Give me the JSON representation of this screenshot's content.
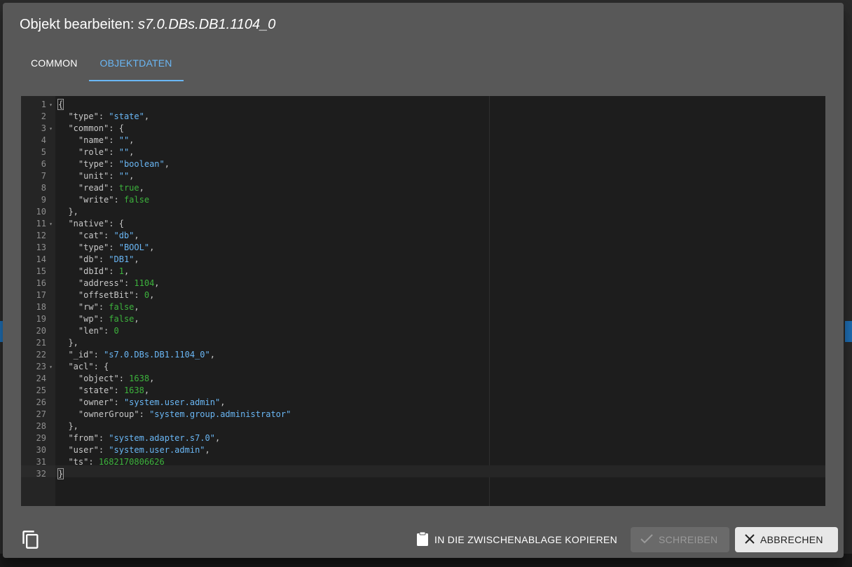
{
  "dialog": {
    "title_prefix": "Objekt bearbeiten: ",
    "title_object_id": "s7.0.DBs.DB1.1104_0",
    "tabs": [
      {
        "label": "COMMON",
        "active": false
      },
      {
        "label": "OBJEKTDATEN",
        "active": true
      }
    ]
  },
  "editor": {
    "language": "json",
    "active_line": 32,
    "lines": [
      {
        "n": "1",
        "fold": true,
        "tokens": [
          [
            "p",
            "{"
          ]
        ]
      },
      {
        "n": "2",
        "fold": false,
        "tokens": [
          [
            "p",
            "  "
          ],
          [
            "k",
            "\"type\""
          ],
          [
            "p",
            ": "
          ],
          [
            "s",
            "\"state\""
          ],
          [
            "p",
            ","
          ]
        ]
      },
      {
        "n": "3",
        "fold": true,
        "tokens": [
          [
            "p",
            "  "
          ],
          [
            "k",
            "\"common\""
          ],
          [
            "p",
            ": {"
          ]
        ]
      },
      {
        "n": "4",
        "fold": false,
        "tokens": [
          [
            "p",
            "    "
          ],
          [
            "k",
            "\"name\""
          ],
          [
            "p",
            ": "
          ],
          [
            "s",
            "\"\""
          ],
          [
            "p",
            ","
          ]
        ]
      },
      {
        "n": "5",
        "fold": false,
        "tokens": [
          [
            "p",
            "    "
          ],
          [
            "k",
            "\"role\""
          ],
          [
            "p",
            ": "
          ],
          [
            "s",
            "\"\""
          ],
          [
            "p",
            ","
          ]
        ]
      },
      {
        "n": "6",
        "fold": false,
        "tokens": [
          [
            "p",
            "    "
          ],
          [
            "k",
            "\"type\""
          ],
          [
            "p",
            ": "
          ],
          [
            "s",
            "\"boolean\""
          ],
          [
            "p",
            ","
          ]
        ]
      },
      {
        "n": "7",
        "fold": false,
        "tokens": [
          [
            "p",
            "    "
          ],
          [
            "k",
            "\"unit\""
          ],
          [
            "p",
            ": "
          ],
          [
            "s",
            "\"\""
          ],
          [
            "p",
            ","
          ]
        ]
      },
      {
        "n": "8",
        "fold": false,
        "tokens": [
          [
            "p",
            "    "
          ],
          [
            "k",
            "\"read\""
          ],
          [
            "p",
            ": "
          ],
          [
            "n",
            "true"
          ],
          [
            "p",
            ","
          ]
        ]
      },
      {
        "n": "9",
        "fold": false,
        "tokens": [
          [
            "p",
            "    "
          ],
          [
            "k",
            "\"write\""
          ],
          [
            "p",
            ": "
          ],
          [
            "n",
            "false"
          ]
        ]
      },
      {
        "n": "10",
        "fold": false,
        "tokens": [
          [
            "p",
            "  },"
          ]
        ]
      },
      {
        "n": "11",
        "fold": true,
        "tokens": [
          [
            "p",
            "  "
          ],
          [
            "k",
            "\"native\""
          ],
          [
            "p",
            ": {"
          ]
        ]
      },
      {
        "n": "12",
        "fold": false,
        "tokens": [
          [
            "p",
            "    "
          ],
          [
            "k",
            "\"cat\""
          ],
          [
            "p",
            ": "
          ],
          [
            "s",
            "\"db\""
          ],
          [
            "p",
            ","
          ]
        ]
      },
      {
        "n": "13",
        "fold": false,
        "tokens": [
          [
            "p",
            "    "
          ],
          [
            "k",
            "\"type\""
          ],
          [
            "p",
            ": "
          ],
          [
            "s",
            "\"BOOL\""
          ],
          [
            "p",
            ","
          ]
        ]
      },
      {
        "n": "14",
        "fold": false,
        "tokens": [
          [
            "p",
            "    "
          ],
          [
            "k",
            "\"db\""
          ],
          [
            "p",
            ": "
          ],
          [
            "s",
            "\"DB1\""
          ],
          [
            "p",
            ","
          ]
        ]
      },
      {
        "n": "15",
        "fold": false,
        "tokens": [
          [
            "p",
            "    "
          ],
          [
            "k",
            "\"dbId\""
          ],
          [
            "p",
            ": "
          ],
          [
            "n",
            "1"
          ],
          [
            "p",
            ","
          ]
        ]
      },
      {
        "n": "16",
        "fold": false,
        "tokens": [
          [
            "p",
            "    "
          ],
          [
            "k",
            "\"address\""
          ],
          [
            "p",
            ": "
          ],
          [
            "n",
            "1104"
          ],
          [
            "p",
            ","
          ]
        ]
      },
      {
        "n": "17",
        "fold": false,
        "tokens": [
          [
            "p",
            "    "
          ],
          [
            "k",
            "\"offsetBit\""
          ],
          [
            "p",
            ": "
          ],
          [
            "n",
            "0"
          ],
          [
            "p",
            ","
          ]
        ]
      },
      {
        "n": "18",
        "fold": false,
        "tokens": [
          [
            "p",
            "    "
          ],
          [
            "k",
            "\"rw\""
          ],
          [
            "p",
            ": "
          ],
          [
            "n",
            "false"
          ],
          [
            "p",
            ","
          ]
        ]
      },
      {
        "n": "19",
        "fold": false,
        "tokens": [
          [
            "p",
            "    "
          ],
          [
            "k",
            "\"wp\""
          ],
          [
            "p",
            ": "
          ],
          [
            "n",
            "false"
          ],
          [
            "p",
            ","
          ]
        ]
      },
      {
        "n": "20",
        "fold": false,
        "tokens": [
          [
            "p",
            "    "
          ],
          [
            "k",
            "\"len\""
          ],
          [
            "p",
            ": "
          ],
          [
            "n",
            "0"
          ]
        ]
      },
      {
        "n": "21",
        "fold": false,
        "tokens": [
          [
            "p",
            "  },"
          ]
        ]
      },
      {
        "n": "22",
        "fold": false,
        "tokens": [
          [
            "p",
            "  "
          ],
          [
            "k",
            "\"_id\""
          ],
          [
            "p",
            ": "
          ],
          [
            "s",
            "\"s7.0.DBs.DB1.1104_0\""
          ],
          [
            "p",
            ","
          ]
        ]
      },
      {
        "n": "23",
        "fold": true,
        "tokens": [
          [
            "p",
            "  "
          ],
          [
            "k",
            "\"acl\""
          ],
          [
            "p",
            ": {"
          ]
        ]
      },
      {
        "n": "24",
        "fold": false,
        "tokens": [
          [
            "p",
            "    "
          ],
          [
            "k",
            "\"object\""
          ],
          [
            "p",
            ": "
          ],
          [
            "n",
            "1638"
          ],
          [
            "p",
            ","
          ]
        ]
      },
      {
        "n": "25",
        "fold": false,
        "tokens": [
          [
            "p",
            "    "
          ],
          [
            "k",
            "\"state\""
          ],
          [
            "p",
            ": "
          ],
          [
            "n",
            "1638"
          ],
          [
            "p",
            ","
          ]
        ]
      },
      {
        "n": "26",
        "fold": false,
        "tokens": [
          [
            "p",
            "    "
          ],
          [
            "k",
            "\"owner\""
          ],
          [
            "p",
            ": "
          ],
          [
            "s",
            "\"system.user.admin\""
          ],
          [
            "p",
            ","
          ]
        ]
      },
      {
        "n": "27",
        "fold": false,
        "tokens": [
          [
            "p",
            "    "
          ],
          [
            "k",
            "\"ownerGroup\""
          ],
          [
            "p",
            ": "
          ],
          [
            "s",
            "\"system.group.administrator\""
          ]
        ]
      },
      {
        "n": "28",
        "fold": false,
        "tokens": [
          [
            "p",
            "  },"
          ]
        ]
      },
      {
        "n": "29",
        "fold": false,
        "tokens": [
          [
            "p",
            "  "
          ],
          [
            "k",
            "\"from\""
          ],
          [
            "p",
            ": "
          ],
          [
            "s",
            "\"system.adapter.s7.0\""
          ],
          [
            "p",
            ","
          ]
        ]
      },
      {
        "n": "30",
        "fold": false,
        "tokens": [
          [
            "p",
            "  "
          ],
          [
            "k",
            "\"user\""
          ],
          [
            "p",
            ": "
          ],
          [
            "s",
            "\"system.user.admin\""
          ],
          [
            "p",
            ","
          ]
        ]
      },
      {
        "n": "31",
        "fold": false,
        "tokens": [
          [
            "p",
            "  "
          ],
          [
            "k",
            "\"ts\""
          ],
          [
            "p",
            ": "
          ],
          [
            "n",
            "1682170806626"
          ]
        ]
      },
      {
        "n": "32",
        "fold": false,
        "tokens": [
          [
            "p",
            "}"
          ]
        ]
      }
    ]
  },
  "footer": {
    "clipboard_label": "IN DIE ZWISCHENABLAGE KOPIEREN",
    "write_label": "SCHREIBEN",
    "cancel_label": "ABBRECHEN",
    "write_enabled": false
  },
  "colors": {
    "accent": "#6ab7f5",
    "string": "#6ab7f5",
    "literal": "#3db33d",
    "dialog_bg": "#585858",
    "editor_bg": "#1d1d1d"
  }
}
